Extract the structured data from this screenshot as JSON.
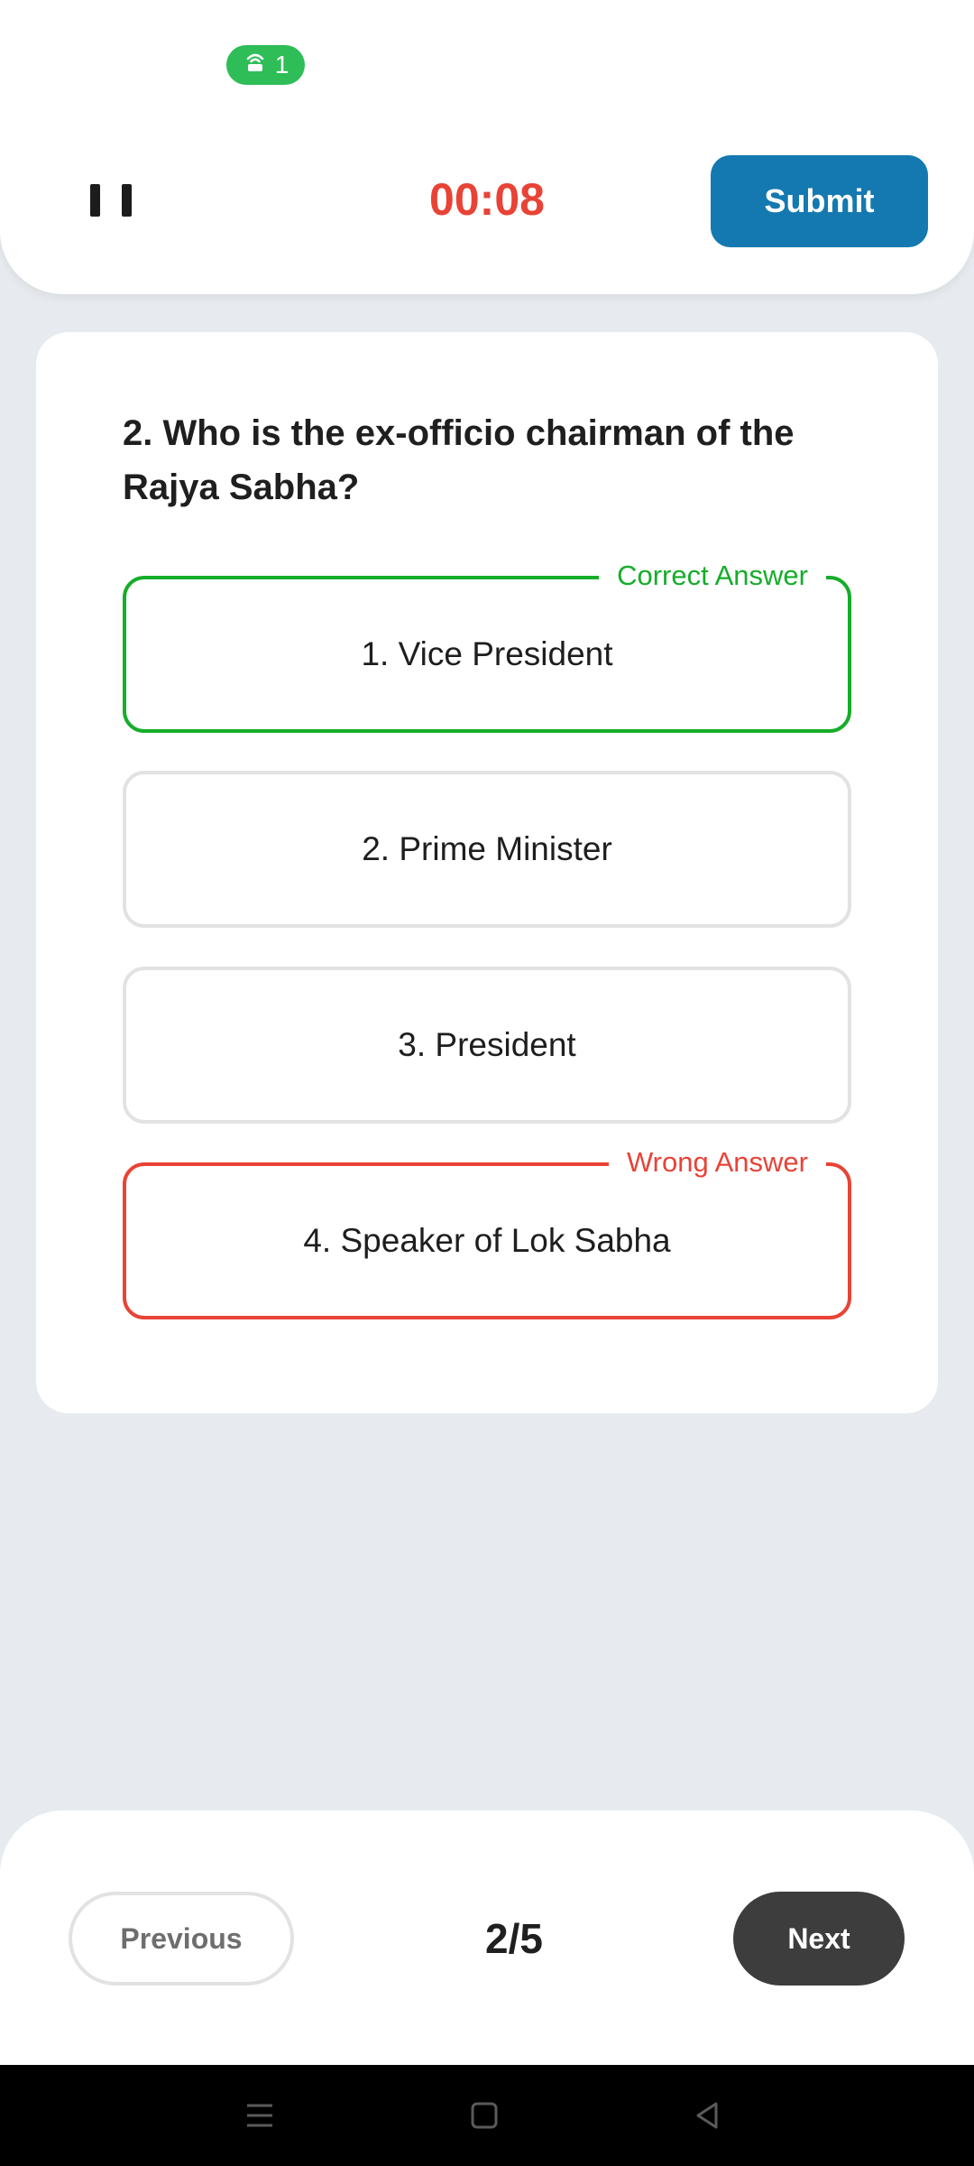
{
  "status": {
    "hotspot_count": "1"
  },
  "header": {
    "timer": "00:08",
    "submit_label": "Submit"
  },
  "question": {
    "text": "2. Who is the ex-officio chairman of the Rajya Sabha?",
    "options": [
      {
        "label": "1. Vice President",
        "state": "correct",
        "tag": "Correct Answer"
      },
      {
        "label": "2. Prime Minister",
        "state": "neutral"
      },
      {
        "label": "3. President",
        "state": "neutral"
      },
      {
        "label": "4. Speaker of Lok Sabha",
        "state": "wrong",
        "tag": "Wrong Answer"
      }
    ]
  },
  "footer": {
    "previous_label": "Previous",
    "page_indicator": "2/5",
    "next_label": "Next"
  },
  "colors": {
    "correct": "#16ad2a",
    "wrong": "#e84336",
    "submit": "#1479b0",
    "timer": "#e84336",
    "hotspot": "#2ebd57",
    "next_button": "#3d3d3d"
  },
  "icons": {
    "hotspot": "hotspot-icon",
    "pause": "pause-icon",
    "nav_menu": "menu-icon",
    "nav_home": "home-icon",
    "nav_back": "back-icon"
  }
}
